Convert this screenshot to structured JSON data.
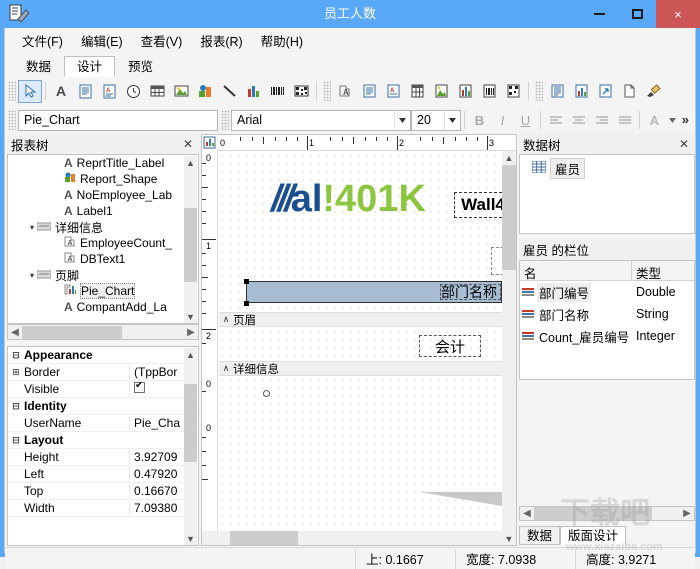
{
  "window": {
    "title": "员工人数",
    "app_icon": "report-designer-icon",
    "buttons": {
      "minimize": "minimize-icon",
      "maximize": "maximize-icon",
      "close": "×"
    }
  },
  "menu": [
    {
      "label": "文件(F)"
    },
    {
      "label": "编辑(E)"
    },
    {
      "label": "查看(V)"
    },
    {
      "label": "报表(R)"
    },
    {
      "label": "帮助(H)"
    }
  ],
  "tabs": [
    {
      "label": "数据",
      "active": false
    },
    {
      "label": "设计",
      "active": true
    },
    {
      "label": "预览",
      "active": false
    }
  ],
  "toolbar": {
    "tools": [
      {
        "name": "select-arrow-icon",
        "glyph": "arrow"
      },
      {
        "name": "label-icon",
        "glyph": "A"
      },
      {
        "name": "memo-icon",
        "glyph": "doc"
      },
      {
        "name": "rich-text-icon",
        "glyph": "docr"
      },
      {
        "name": "system-time-icon",
        "glyph": "clock"
      },
      {
        "name": "table-icon",
        "glyph": "grid"
      },
      {
        "name": "image-icon",
        "glyph": "image"
      },
      {
        "name": "shape-icon",
        "glyph": "shape"
      },
      {
        "name": "line-icon",
        "glyph": "line"
      },
      {
        "name": "chart-icon",
        "glyph": "chart"
      },
      {
        "name": "barcode-icon",
        "glyph": "barcode"
      },
      {
        "name": "qrcode-icon",
        "glyph": "qrcode"
      },
      {
        "name": "db-label-icon",
        "glyph": "dbA"
      },
      {
        "name": "db-memo-icon",
        "glyph": "dbdoc"
      },
      {
        "name": "db-richtext-icon",
        "glyph": "dbdocr"
      },
      {
        "name": "db-calc-icon",
        "glyph": "dbgrid"
      },
      {
        "name": "db-image-icon",
        "glyph": "dbimage"
      },
      {
        "name": "db-chart-icon",
        "glyph": "dbchart"
      },
      {
        "name": "db-barcode-icon",
        "glyph": "dbbarcode"
      },
      {
        "name": "db-qrcode-icon",
        "glyph": "dbqrcode"
      },
      {
        "name": "report-settings-icon",
        "glyph": "rep1"
      },
      {
        "name": "report-chart-icon",
        "glyph": "rep2"
      },
      {
        "name": "page-setup-icon",
        "glyph": "rep3"
      },
      {
        "name": "new-page-icon",
        "glyph": "rep4"
      },
      {
        "name": "format-brush-icon",
        "glyph": "brush"
      }
    ],
    "object_name": "Pie_Chart",
    "font_name": "Arial",
    "font_size": "20",
    "bold": "B",
    "italic": "I",
    "underline": "U",
    "align_left": "align-left-icon",
    "align_center": "align-center-icon",
    "align_right": "align-right-icon",
    "align_justify": "align-justify-icon",
    "font_color": "A",
    "overflow": "»"
  },
  "report_tree": {
    "title": "报表树",
    "close": "✕",
    "items": [
      {
        "label": "ReprtTitle_Label",
        "icon": "label-icon",
        "indent": 56,
        "selected": false
      },
      {
        "label": "Report_Shape",
        "icon": "shape-icon",
        "indent": 56,
        "selected": false
      },
      {
        "label": "NoEmployee_Lab",
        "icon": "label-icon",
        "indent": 56,
        "selected": false
      },
      {
        "label": "Label1",
        "icon": "label-icon",
        "indent": 56,
        "selected": false
      },
      {
        "label": "详细信息",
        "icon": "band-icon",
        "indent": 26,
        "selected": false
      },
      {
        "label": "EmployeeCount_",
        "icon": "db-label-icon",
        "indent": 56,
        "selected": false
      },
      {
        "label": "DBText1",
        "icon": "db-label-icon",
        "indent": 56,
        "selected": false
      },
      {
        "label": "页脚",
        "icon": "band-icon",
        "indent": 26,
        "selected": false
      },
      {
        "label": "Pie_Chart",
        "icon": "chart-icon",
        "indent": 56,
        "selected": true
      },
      {
        "label": "CompantAdd_La",
        "icon": "label-icon",
        "indent": 56,
        "selected": false
      }
    ]
  },
  "properties": {
    "rows": [
      {
        "kind": "category",
        "expander": "⊟",
        "name": "Appearance",
        "value": ""
      },
      {
        "kind": "prop",
        "expander": "⊞",
        "name": "Border",
        "value": "(TppBor"
      },
      {
        "kind": "prop",
        "expander": "",
        "name": "Visible",
        "value": "checkbox"
      },
      {
        "kind": "category",
        "expander": "⊟",
        "name": "Identity",
        "value": ""
      },
      {
        "kind": "prop",
        "expander": "",
        "name": "UserName",
        "value": "Pie_Cha"
      },
      {
        "kind": "category",
        "expander": "⊟",
        "name": "Layout",
        "value": ""
      },
      {
        "kind": "prop",
        "expander": "",
        "name": "Height",
        "value": "3.92709"
      },
      {
        "kind": "prop",
        "expander": "",
        "name": "Left",
        "value": "0.47920"
      },
      {
        "kind": "prop",
        "expander": "",
        "name": "Top",
        "value": "0.16670"
      },
      {
        "kind": "prop",
        "expander": "",
        "name": "Width",
        "value": "7.09380"
      }
    ]
  },
  "designer": {
    "ruler_h_labels": [
      "0",
      "1",
      "2",
      "3"
    ],
    "ruler_v_labels": [
      "0",
      "1",
      "2",
      "0",
      "0"
    ],
    "logo": {
      "slashes": "///",
      "word1": "al",
      "bang": "!",
      "word2": "401K",
      "colors": {
        "blue": "#1b4f8f",
        "lightblue": "#2e9ad6",
        "green": "#8cc63f"
      }
    },
    "logo_label_text": "Wall4",
    "selected_label_text": "部门名称",
    "bands": [
      {
        "label": "页眉",
        "caret": "∧"
      },
      {
        "label": "详细信息",
        "caret": "∧"
      }
    ],
    "detail_text": "会计"
  },
  "data_tree": {
    "title": "数据树",
    "close": "✕",
    "table": {
      "label": "雇员",
      "icon": "table-icon"
    },
    "fields_header": "雇员 的栏位",
    "columns": [
      "名",
      "类型"
    ],
    "rows": [
      {
        "name": "部门编号",
        "type": "Double",
        "selected": true
      },
      {
        "name": "部门名称",
        "type": "String",
        "selected": false
      },
      {
        "name": "Count_雇员编号",
        "type": "Integer",
        "selected": false
      }
    ],
    "tabs": [
      {
        "label": "数据",
        "active": false
      },
      {
        "label": "版面设计",
        "active": true
      }
    ]
  },
  "statusbar": {
    "top": "上: 0.1667",
    "width": "宽度: 7.0938",
    "height": "高度: 3.9271"
  },
  "watermark": {
    "text": "下载吧",
    "url": "www.xiazaiba.com"
  }
}
